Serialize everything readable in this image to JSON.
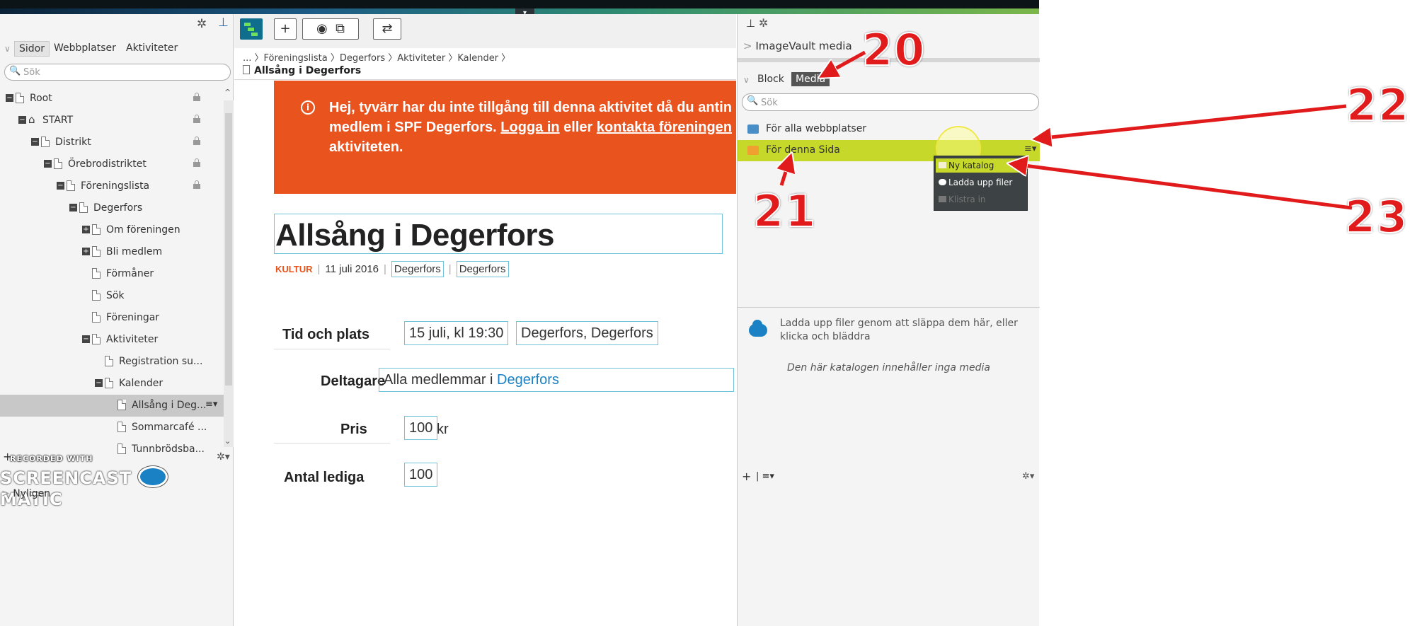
{
  "left_panel": {
    "tabs": [
      "Sidor",
      "Webbplatser",
      "Aktiviteter"
    ],
    "search_placeholder": "Sök",
    "tree": [
      {
        "label": "Root",
        "depth": 0,
        "icon": "root-icon",
        "expand": "−",
        "locked": true
      },
      {
        "label": "START",
        "depth": 1,
        "icon": "home-icon",
        "expand": "−",
        "locked": true
      },
      {
        "label": "Distrikt",
        "depth": 2,
        "icon": "page-icon",
        "expand": "−",
        "locked": true
      },
      {
        "label": "Örebrodistriktet",
        "depth": 3,
        "icon": "page-icon",
        "expand": "−",
        "locked": true
      },
      {
        "label": "Föreningslista",
        "depth": 4,
        "icon": "page-icon",
        "expand": "−",
        "locked": true
      },
      {
        "label": "Degerfors",
        "depth": 5,
        "icon": "page-icon",
        "expand": "−",
        "locked": false
      },
      {
        "label": "Om föreningen",
        "depth": 6,
        "icon": "page-icon",
        "expand": "+",
        "locked": false
      },
      {
        "label": "Bli medlem",
        "depth": 6,
        "icon": "page-icon",
        "expand": "+",
        "locked": false
      },
      {
        "label": "Förmåner",
        "depth": 6,
        "icon": "page-icon",
        "expand": "",
        "locked": false
      },
      {
        "label": "Sök",
        "depth": 6,
        "icon": "page-icon",
        "expand": "",
        "locked": false
      },
      {
        "label": "Föreningar",
        "depth": 6,
        "icon": "page-icon",
        "expand": "",
        "locked": false
      },
      {
        "label": "Aktiviteter",
        "depth": 6,
        "icon": "page-icon",
        "expand": "−",
        "locked": false
      },
      {
        "label": "Registration su...",
        "depth": 7,
        "icon": "page-icon",
        "expand": "",
        "locked": false
      },
      {
        "label": "Kalender",
        "depth": 7,
        "icon": "page-icon",
        "expand": "−",
        "locked": false
      },
      {
        "label": "Allsång i Deg...",
        "depth": 8,
        "icon": "page-icon",
        "expand": "",
        "locked": false,
        "selected": true
      },
      {
        "label": "Sommarcafé ...",
        "depth": 8,
        "icon": "page-icon",
        "expand": "",
        "locked": false
      },
      {
        "label": "Tunnbrödsba...",
        "depth": 8,
        "icon": "page-icon",
        "expand": "",
        "locked": false
      }
    ],
    "recorded_with": "RECORDED WITH",
    "screencast_left": "SCREENCAST",
    "screencast_right": "MATIC",
    "recent_label": "Nyligen"
  },
  "center": {
    "breadcrumb": "... 〉Föreningslista 〉Degerfors 〉Aktiviteter 〉Kalender 〉",
    "page_title": "Allsång i Degerfors",
    "alert": {
      "line1": "Hej, tyvärr har du inte tillgång till denna aktivitet då du antin",
      "line2_a": "medlem i SPF Degerfors. ",
      "line2_link1": "Logga in",
      "line2_b": " eller ",
      "line2_link2": "kontakta föreningen",
      "line3": "aktiviteten."
    },
    "heading": "Allsång i Degerfors",
    "meta": {
      "category": "KULTUR",
      "date": "11 juli 2016",
      "place1": "Degerfors",
      "place2": "Degerfors"
    },
    "fields": [
      {
        "label": "Tid och plats",
        "value_a": "15 juli, kl 19:30",
        "value_b": "Degerfors, Degerfors"
      },
      {
        "label": "Deltagare",
        "value_a": "Alla medlemmar i ",
        "value_link": "Degerfors"
      },
      {
        "label": "Pris",
        "value_a": "100",
        "value_b": "kr"
      },
      {
        "label": "Antal lediga",
        "value_a": "100"
      }
    ]
  },
  "right_panel": {
    "imagevault": "ImageVault media",
    "tabs": [
      "Block",
      "Media"
    ],
    "search_placeholder": "Sök",
    "folders": [
      "För alla webbplatser",
      "För denna Sida"
    ],
    "menu": [
      "Ny katalog",
      "Ladda upp filer",
      "Klistra in"
    ],
    "upload_info": "Ladda upp filer genom att släppa dem här, eller klicka och bläddra",
    "empty_text": "Den här katalogen innehåller inga media"
  },
  "annotations": [
    "20",
    "21",
    "22",
    "23"
  ],
  "colors": {
    "alert": "#e8531e",
    "accent": "#c6d92a",
    "link": "#1a82c4",
    "annotation": "#e11b1b"
  }
}
